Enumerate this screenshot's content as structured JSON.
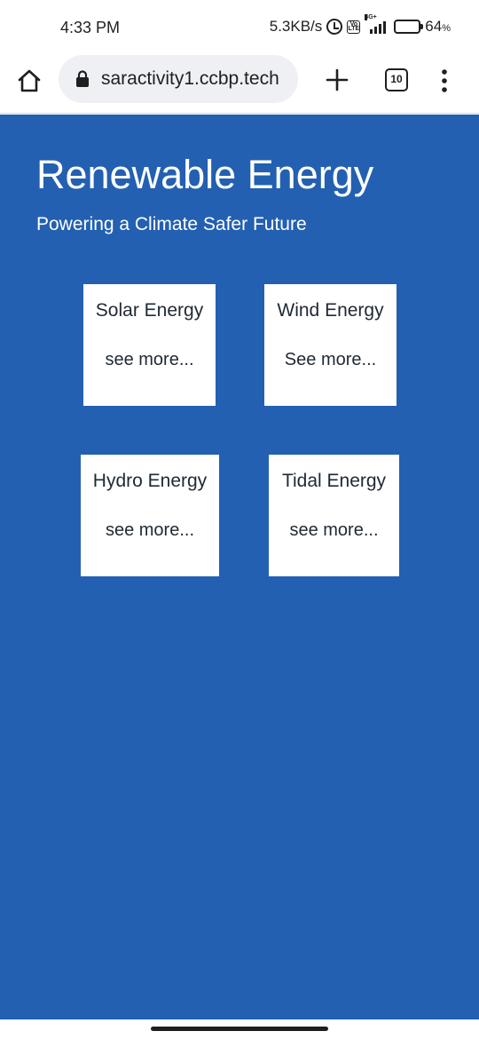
{
  "status_bar": {
    "time": "4:33 PM",
    "network_speed": "5.3KB/s",
    "network_type": "4G+",
    "volte_label": "Vo LTE",
    "battery_percent": "64",
    "battery_unit": "%",
    "icons": [
      "alarm-icon",
      "volte-icon",
      "signal-icon",
      "battery-icon"
    ]
  },
  "browser": {
    "url": "saractivity1.ccbp.tech",
    "tab_count": "10",
    "icons": [
      "home-icon",
      "lock-icon",
      "plus-icon",
      "tabs-icon",
      "more-menu-icon"
    ]
  },
  "page": {
    "background_color": "#2360b1",
    "title": "Renewable Energy",
    "subtitle": "Powering a Climate Safer Future",
    "cards": [
      {
        "title": "Solar Energy",
        "link": "see more..."
      },
      {
        "title": "Wind Energy",
        "link": "See more..."
      },
      {
        "title": "Hydro Energy",
        "link": "see more..."
      },
      {
        "title": "Tidal Energy",
        "link": "see more..."
      }
    ]
  }
}
